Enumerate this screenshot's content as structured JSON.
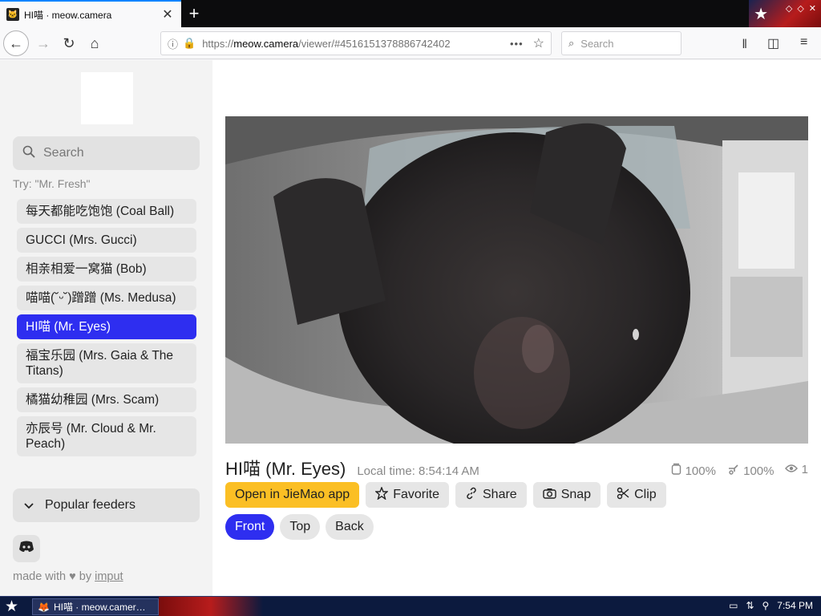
{
  "browser": {
    "tab_title": "HI喵 · meow.camera",
    "tab_favicon": "cat-icon",
    "url_host_prefix": "https://",
    "url_host": "meow.camera",
    "url_rest": "/viewer/#4516151378886742402",
    "search_placeholder": "Search"
  },
  "sidebar": {
    "search_placeholder": "Search",
    "hint": "Try: \"Mr. Fresh\"",
    "cameras": [
      {
        "label": "每天都能吃饱饱 (Coal Ball)",
        "active": false
      },
      {
        "label": "GUCCI (Mrs. Gucci)",
        "active": false
      },
      {
        "label": "相亲相爱一窝猫 (Bob)",
        "active": false
      },
      {
        "label": "喵喵(˘ᵕ˘)蹭蹭 (Ms. Medusa)",
        "active": false
      },
      {
        "label": "HI喵 (Mr. Eyes)",
        "active": true
      },
      {
        "label": "福宝乐园 (Mrs. Gaia & The Titans)",
        "active": false
      },
      {
        "label": "橘猫幼稚园 (Mrs. Scam)",
        "active": false
      },
      {
        "label": "亦辰号 (Mr. Cloud & Mr. Peach)",
        "active": false
      }
    ],
    "popular_label": "Popular feeders",
    "credit_prefix": "made with",
    "credit_by": "by",
    "credit_author": "imput"
  },
  "viewer": {
    "camera_name": "HI喵 (Mr. Eyes)",
    "local_time": "Local time: 8:54:14 AM",
    "food_level": "100%",
    "water_level": "100%",
    "viewers": "1",
    "actions": {
      "open_app": "Open in JieMao app",
      "favorite": "Favorite",
      "share": "Share",
      "snap": "Snap",
      "clip": "Clip"
    },
    "views": [
      {
        "label": "Front",
        "active": true
      },
      {
        "label": "Top",
        "active": false
      },
      {
        "label": "Back",
        "active": false
      }
    ]
  },
  "taskbar": {
    "task_label": "HI喵 · meow.camer…",
    "clock": "7:54 PM"
  },
  "colors": {
    "accent_blue": "#2e2ef0",
    "app_button_yellow": "#fbbf24",
    "firefox_blue": "#0a84ff"
  }
}
